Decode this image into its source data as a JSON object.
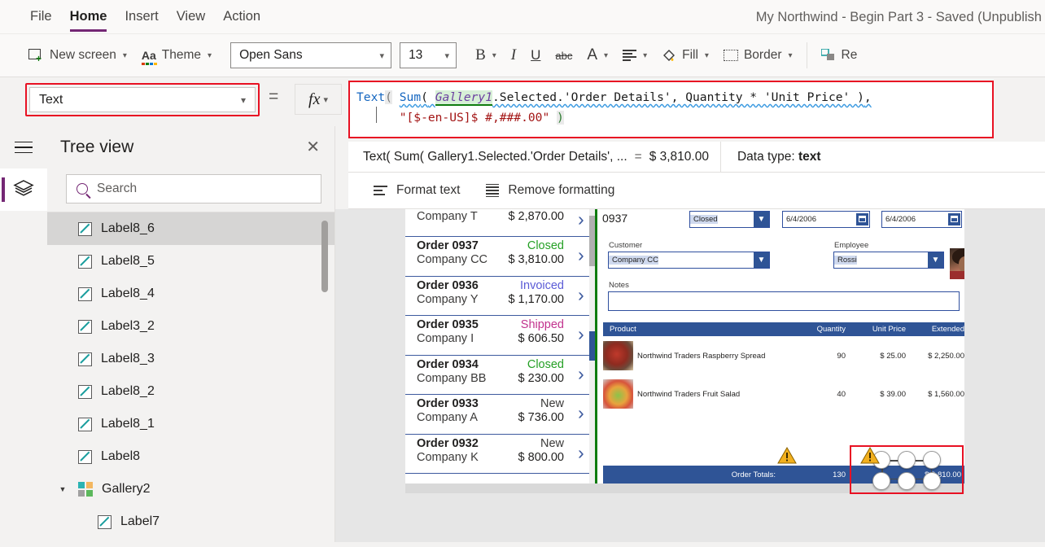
{
  "menu": {
    "items": [
      {
        "label": "File",
        "active": false
      },
      {
        "label": "Home",
        "active": true
      },
      {
        "label": "Insert",
        "active": false
      },
      {
        "label": "View",
        "active": false
      },
      {
        "label": "Action",
        "active": false
      }
    ],
    "app_title": "My Northwind - Begin Part 3 - Saved (Unpublish"
  },
  "ribbon": {
    "new_screen": "New screen",
    "theme": "Theme",
    "font_name": "Open Sans",
    "font_size": "13",
    "bold": "B",
    "italic": "I",
    "underline": "U",
    "strikethrough": "abc",
    "font_color": "A",
    "align": "align-icon",
    "fill": "Fill",
    "border": "Border",
    "reorder": "Re"
  },
  "property_bar": {
    "selected_property": "Text",
    "equals": "=",
    "fx_label": "fx"
  },
  "formula": {
    "line1": {
      "fn_text": "Text",
      "open1": "(",
      "space1": " ",
      "fn_sum": "Sum",
      "open2": "(",
      "space2": " ",
      "identifier": "Gallery1",
      "rest": ".Selected.'Order Details', Quantity * 'Unit Price' ",
      "close1": ")",
      "comma": ","
    },
    "line2": {
      "indent": "      ",
      "string": "\"[$-en-US]$ #,###.00\"",
      "space": " ",
      "close2": ")"
    },
    "full_text": "Text( Sum( Gallery1.Selected.'Order Details', Quantity * 'Unit Price' ),\n      \"[$-en-US]$ #,###.00\" )"
  },
  "result_bar": {
    "expression": "Text( Sum( Gallery1.Selected.'Order Details', ...",
    "equals": "=",
    "value": "$ 3,810.00",
    "data_type_label": "Data type:",
    "data_type_value": "text"
  },
  "format_toolbar": {
    "format_text": "Format text",
    "remove_formatting": "Remove formatting"
  },
  "tree_view": {
    "title": "Tree view",
    "close": "✕",
    "search_placeholder": "Search",
    "search_value": "",
    "items": [
      {
        "label": "Label8_6",
        "icon": "label-icon",
        "indent": 0,
        "selected": true,
        "expandable": false
      },
      {
        "label": "Label8_5",
        "icon": "label-icon",
        "indent": 0,
        "selected": false,
        "expandable": false
      },
      {
        "label": "Label8_4",
        "icon": "label-icon",
        "indent": 0,
        "selected": false,
        "expandable": false
      },
      {
        "label": "Label3_2",
        "icon": "label-icon",
        "indent": 0,
        "selected": false,
        "expandable": false
      },
      {
        "label": "Label8_3",
        "icon": "label-icon",
        "indent": 0,
        "selected": false,
        "expandable": false
      },
      {
        "label": "Label8_2",
        "icon": "label-icon",
        "indent": 0,
        "selected": false,
        "expandable": false
      },
      {
        "label": "Label8_1",
        "icon": "label-icon",
        "indent": 0,
        "selected": false,
        "expandable": false
      },
      {
        "label": "Label8",
        "icon": "label-icon",
        "indent": 0,
        "selected": false,
        "expandable": false
      },
      {
        "label": "Gallery2",
        "icon": "gallery-icon",
        "indent": 0,
        "selected": false,
        "expandable": true
      },
      {
        "label": "Label7",
        "icon": "label-icon",
        "indent": 1,
        "selected": false,
        "expandable": false
      }
    ]
  },
  "app_canvas": {
    "order_gallery": {
      "items": [
        {
          "order": "",
          "status": "",
          "company": "Company T",
          "amount": "$ 2,870.00",
          "status_class": "status-new",
          "partial": true,
          "selected": false
        },
        {
          "order": "Order 0937",
          "status": "Closed",
          "company": "Company CC",
          "amount": "$ 3,810.00",
          "status_class": "status-closed",
          "partial": false,
          "selected": true
        },
        {
          "order": "Order 0936",
          "status": "Invoiced",
          "company": "Company Y",
          "amount": "$ 1,170.00",
          "status_class": "status-invoiced",
          "partial": false,
          "selected": false
        },
        {
          "order": "Order 0935",
          "status": "Shipped",
          "company": "Company I",
          "amount": "$ 606.50",
          "status_class": "status-shipped",
          "partial": false,
          "selected": false
        },
        {
          "order": "Order 0934",
          "status": "Closed",
          "company": "Company BB",
          "amount": "$ 230.00",
          "status_class": "status-closed",
          "partial": false,
          "selected": false
        },
        {
          "order": "Order 0933",
          "status": "New",
          "company": "Company A",
          "amount": "$ 736.00",
          "status_class": "status-new",
          "partial": false,
          "selected": false
        },
        {
          "order": "Order 0932",
          "status": "New",
          "company": "Company K",
          "amount": "$ 800.00",
          "status_class": "status-new",
          "partial": false,
          "selected": false
        }
      ]
    },
    "detail_form": {
      "order_number": "0937",
      "status_value": "Closed",
      "date1_value": "6/4/2006",
      "date2_value": "6/4/2006",
      "customer_label": "Customer",
      "customer_value": "Company CC",
      "employee_label": "Employee",
      "employee_value": "Rossi",
      "notes_label": "Notes",
      "notes_value": ""
    },
    "products_table": {
      "headers": [
        "Product",
        "Quantity",
        "Unit Price",
        "Extended"
      ],
      "rows": [
        {
          "product": "Northwind Traders Raspberry Spread",
          "quantity": "90",
          "unit_price": "$ 25.00",
          "extended": "$ 2,250.00",
          "thumb": "raspberry-spread-thumb"
        },
        {
          "product": "Northwind Traders Fruit Salad",
          "quantity": "40",
          "unit_price": "$ 39.00",
          "extended": "$ 1,560.00",
          "thumb": "fruit-salad-thumb"
        }
      ],
      "totals": {
        "label": "Order Totals:",
        "quantity": "130",
        "unit_price": "",
        "extended": "$ 3,810.00"
      }
    }
  },
  "colors": {
    "accent_purple": "#742774",
    "highlight_red": "#e81123",
    "app_blue": "#2f5496",
    "warn_yellow": "#f2b01e",
    "status_closed": "#25a025",
    "status_invoiced": "#5b5bd6",
    "status_shipped": "#c2338e"
  }
}
